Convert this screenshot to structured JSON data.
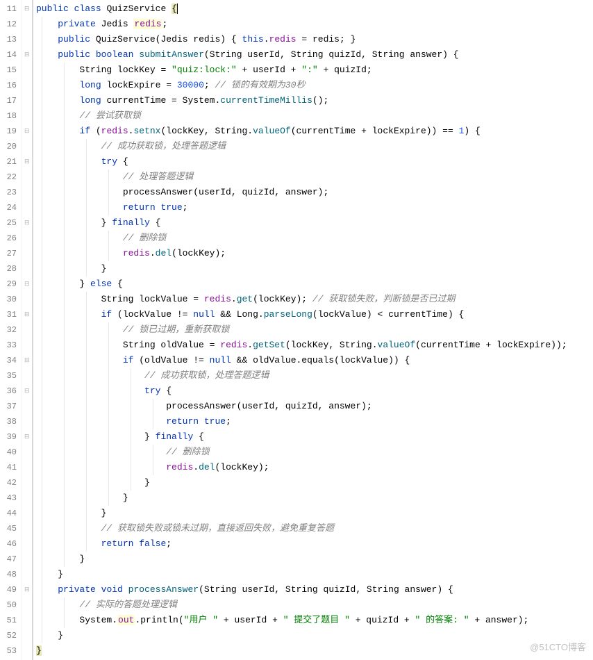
{
  "lines": [
    {
      "num": "11",
      "indent": 0,
      "tokens": [
        {
          "t": "public",
          "c": "kw"
        },
        {
          "t": " ",
          "c": ""
        },
        {
          "t": "class",
          "c": "kw"
        },
        {
          "t": " ",
          "c": ""
        },
        {
          "t": "QuizService",
          "c": "cls"
        },
        {
          "t": " ",
          "c": ""
        },
        {
          "t": "{",
          "c": "hl cursor"
        }
      ]
    },
    {
      "num": "12",
      "indent": 1,
      "tokens": [
        {
          "t": "private",
          "c": "kw"
        },
        {
          "t": " ",
          "c": ""
        },
        {
          "t": "Jedis",
          "c": "cls"
        },
        {
          "t": " ",
          "c": ""
        },
        {
          "t": "redis",
          "c": "fld hl2"
        },
        {
          "t": ";",
          "c": "txt"
        }
      ]
    },
    {
      "num": "13",
      "indent": 1,
      "tokens": [
        {
          "t": "public",
          "c": "kw"
        },
        {
          "t": " ",
          "c": ""
        },
        {
          "t": "QuizService",
          "c": "cls"
        },
        {
          "t": "(",
          "c": "txt"
        },
        {
          "t": "Jedis",
          "c": "cls"
        },
        {
          "t": " redis) { ",
          "c": "txt"
        },
        {
          "t": "this",
          "c": "kw"
        },
        {
          "t": ".",
          "c": "txt"
        },
        {
          "t": "redis",
          "c": "fld"
        },
        {
          "t": " = redis; }",
          "c": "txt"
        }
      ]
    },
    {
      "num": "14",
      "indent": 1,
      "tokens": [
        {
          "t": "public",
          "c": "kw"
        },
        {
          "t": " ",
          "c": ""
        },
        {
          "t": "boolean",
          "c": "kw"
        },
        {
          "t": " ",
          "c": ""
        },
        {
          "t": "submitAnswer",
          "c": "mth"
        },
        {
          "t": "(String userId, String quizId, String answer) {",
          "c": "txt"
        }
      ]
    },
    {
      "num": "15",
      "indent": 2,
      "tokens": [
        {
          "t": "String lockKey = ",
          "c": "txt"
        },
        {
          "t": "\"quiz:lock:\"",
          "c": "str"
        },
        {
          "t": " + userId + ",
          "c": "txt"
        },
        {
          "t": "\":\"",
          "c": "str"
        },
        {
          "t": " + quizId;",
          "c": "txt"
        }
      ]
    },
    {
      "num": "16",
      "indent": 2,
      "tokens": [
        {
          "t": "long",
          "c": "kw"
        },
        {
          "t": " lockExpire = ",
          "c": "txt"
        },
        {
          "t": "30000",
          "c": "num"
        },
        {
          "t": "; ",
          "c": "txt"
        },
        {
          "t": "// 锁的有效期为30秒",
          "c": "cmt"
        }
      ]
    },
    {
      "num": "17",
      "indent": 2,
      "tokens": [
        {
          "t": "long",
          "c": "kw"
        },
        {
          "t": " currentTime = System.",
          "c": "txt"
        },
        {
          "t": "currentTimeMillis",
          "c": "mth"
        },
        {
          "t": "();",
          "c": "txt"
        }
      ]
    },
    {
      "num": "18",
      "indent": 2,
      "tokens": [
        {
          "t": "// 尝试获取锁",
          "c": "cmt"
        }
      ]
    },
    {
      "num": "19",
      "indent": 2,
      "tokens": [
        {
          "t": "if",
          "c": "kw"
        },
        {
          "t": " (",
          "c": "txt"
        },
        {
          "t": "redis",
          "c": "fld"
        },
        {
          "t": ".",
          "c": "txt"
        },
        {
          "t": "setnx",
          "c": "mth"
        },
        {
          "t": "(lockKey, String.",
          "c": "txt"
        },
        {
          "t": "valueOf",
          "c": "mth"
        },
        {
          "t": "(currentTime + lockExpire)) == ",
          "c": "txt"
        },
        {
          "t": "1",
          "c": "num"
        },
        {
          "t": ") {",
          "c": "txt"
        }
      ]
    },
    {
      "num": "20",
      "indent": 3,
      "tokens": [
        {
          "t": "// 成功获取锁，处理答题逻辑",
          "c": "cmt"
        }
      ]
    },
    {
      "num": "21",
      "indent": 3,
      "tokens": [
        {
          "t": "try",
          "c": "kw"
        },
        {
          "t": " {",
          "c": "txt"
        }
      ]
    },
    {
      "num": "22",
      "indent": 4,
      "tokens": [
        {
          "t": "// 处理答题逻辑",
          "c": "cmt"
        }
      ]
    },
    {
      "num": "23",
      "indent": 4,
      "tokens": [
        {
          "t": "processAnswer(userId, quizId, answer);",
          "c": "txt"
        }
      ]
    },
    {
      "num": "24",
      "indent": 4,
      "tokens": [
        {
          "t": "return",
          "c": "kw"
        },
        {
          "t": " ",
          "c": ""
        },
        {
          "t": "true",
          "c": "kw"
        },
        {
          "t": ";",
          "c": "txt"
        }
      ]
    },
    {
      "num": "25",
      "indent": 3,
      "tokens": [
        {
          "t": "} ",
          "c": "txt"
        },
        {
          "t": "finally",
          "c": "kw"
        },
        {
          "t": " {",
          "c": "txt"
        }
      ]
    },
    {
      "num": "26",
      "indent": 4,
      "tokens": [
        {
          "t": "// 删除锁",
          "c": "cmt"
        }
      ]
    },
    {
      "num": "27",
      "indent": 4,
      "tokens": [
        {
          "t": "redis",
          "c": "fld"
        },
        {
          "t": ".",
          "c": "txt"
        },
        {
          "t": "del",
          "c": "mth"
        },
        {
          "t": "(lockKey);",
          "c": "txt"
        }
      ]
    },
    {
      "num": "28",
      "indent": 3,
      "tokens": [
        {
          "t": "}",
          "c": "txt"
        }
      ]
    },
    {
      "num": "29",
      "indent": 2,
      "tokens": [
        {
          "t": "} ",
          "c": "txt"
        },
        {
          "t": "else",
          "c": "kw"
        },
        {
          "t": " {",
          "c": "txt"
        }
      ]
    },
    {
      "num": "30",
      "indent": 3,
      "tokens": [
        {
          "t": "String lockValue = ",
          "c": "txt"
        },
        {
          "t": "redis",
          "c": "fld"
        },
        {
          "t": ".",
          "c": "txt"
        },
        {
          "t": "get",
          "c": "mth"
        },
        {
          "t": "(lockKey); ",
          "c": "txt"
        },
        {
          "t": "// 获取锁失败，判断锁是否已过期",
          "c": "cmt"
        }
      ]
    },
    {
      "num": "31",
      "indent": 3,
      "tokens": [
        {
          "t": "if",
          "c": "kw"
        },
        {
          "t": " (lockValue != ",
          "c": "txt"
        },
        {
          "t": "null",
          "c": "kw"
        },
        {
          "t": " && Long.",
          "c": "txt"
        },
        {
          "t": "parseLong",
          "c": "mth"
        },
        {
          "t": "(lockValue) < currentTime) {",
          "c": "txt"
        }
      ]
    },
    {
      "num": "32",
      "indent": 4,
      "tokens": [
        {
          "t": "// 锁已过期，重新获取锁",
          "c": "cmt"
        }
      ]
    },
    {
      "num": "33",
      "indent": 4,
      "tokens": [
        {
          "t": "String oldValue = ",
          "c": "txt"
        },
        {
          "t": "redis",
          "c": "fld"
        },
        {
          "t": ".",
          "c": "txt"
        },
        {
          "t": "getSet",
          "c": "mth"
        },
        {
          "t": "(lockKey, String.",
          "c": "txt"
        },
        {
          "t": "valueOf",
          "c": "mth"
        },
        {
          "t": "(currentTime + lockExpire));",
          "c": "txt"
        }
      ]
    },
    {
      "num": "34",
      "indent": 4,
      "tokens": [
        {
          "t": "if",
          "c": "kw"
        },
        {
          "t": " (oldValue != ",
          "c": "txt"
        },
        {
          "t": "null",
          "c": "kw"
        },
        {
          "t": " && oldValue.equals(lockValue)) {",
          "c": "txt"
        }
      ]
    },
    {
      "num": "35",
      "indent": 5,
      "tokens": [
        {
          "t": "// 成功获取锁，处理答题逻辑",
          "c": "cmt"
        }
      ]
    },
    {
      "num": "36",
      "indent": 5,
      "tokens": [
        {
          "t": "try",
          "c": "kw"
        },
        {
          "t": " {",
          "c": "txt"
        }
      ]
    },
    {
      "num": "37",
      "indent": 6,
      "tokens": [
        {
          "t": "processAnswer(userId, quizId, answer);",
          "c": "txt"
        }
      ]
    },
    {
      "num": "38",
      "indent": 6,
      "tokens": [
        {
          "t": "return",
          "c": "kw"
        },
        {
          "t": " ",
          "c": ""
        },
        {
          "t": "true",
          "c": "kw"
        },
        {
          "t": ";",
          "c": "txt"
        }
      ]
    },
    {
      "num": "39",
      "indent": 5,
      "tokens": [
        {
          "t": "} ",
          "c": "txt"
        },
        {
          "t": "finally",
          "c": "kw"
        },
        {
          "t": " {",
          "c": "txt"
        }
      ]
    },
    {
      "num": "40",
      "indent": 6,
      "tokens": [
        {
          "t": "// 删除锁",
          "c": "cmt"
        }
      ]
    },
    {
      "num": "41",
      "indent": 6,
      "tokens": [
        {
          "t": "redis",
          "c": "fld"
        },
        {
          "t": ".",
          "c": "txt"
        },
        {
          "t": "del",
          "c": "mth"
        },
        {
          "t": "(lockKey);",
          "c": "txt"
        }
      ]
    },
    {
      "num": "42",
      "indent": 5,
      "tokens": [
        {
          "t": "}",
          "c": "txt"
        }
      ]
    },
    {
      "num": "43",
      "indent": 4,
      "tokens": [
        {
          "t": "}",
          "c": "txt"
        }
      ]
    },
    {
      "num": "44",
      "indent": 3,
      "tokens": [
        {
          "t": "}",
          "c": "txt"
        }
      ]
    },
    {
      "num": "45",
      "indent": 3,
      "tokens": [
        {
          "t": "// 获取锁失败或锁未过期，直接返回失败，避免重复答题",
          "c": "cmt"
        }
      ]
    },
    {
      "num": "46",
      "indent": 3,
      "tokens": [
        {
          "t": "return",
          "c": "kw"
        },
        {
          "t": " ",
          "c": ""
        },
        {
          "t": "false",
          "c": "kw"
        },
        {
          "t": ";",
          "c": "txt"
        }
      ]
    },
    {
      "num": "47",
      "indent": 2,
      "tokens": [
        {
          "t": "}",
          "c": "txt"
        }
      ]
    },
    {
      "num": "48",
      "indent": 1,
      "tokens": [
        {
          "t": "}",
          "c": "txt"
        }
      ]
    },
    {
      "num": "49",
      "indent": 1,
      "tokens": [
        {
          "t": "private",
          "c": "kw"
        },
        {
          "t": " ",
          "c": ""
        },
        {
          "t": "void",
          "c": "kw"
        },
        {
          "t": " ",
          "c": ""
        },
        {
          "t": "processAnswer",
          "c": "mth"
        },
        {
          "t": "(String userId, String quizId, String answer) {",
          "c": "txt"
        }
      ]
    },
    {
      "num": "50",
      "indent": 2,
      "tokens": [
        {
          "t": "// 实际的答题处理逻辑",
          "c": "cmt"
        }
      ]
    },
    {
      "num": "51",
      "indent": 2,
      "tokens": [
        {
          "t": "System.",
          "c": "txt"
        },
        {
          "t": "out",
          "c": "fld hl2"
        },
        {
          "t": ".println(",
          "c": "txt"
        },
        {
          "t": "\"用户 \"",
          "c": "str"
        },
        {
          "t": " + userId + ",
          "c": "txt"
        },
        {
          "t": "\" 提交了题目 \"",
          "c": "str"
        },
        {
          "t": " + quizId + ",
          "c": "txt"
        },
        {
          "t": "\" 的答案: \"",
          "c": "str"
        },
        {
          "t": " + answer);",
          "c": "txt"
        }
      ]
    },
    {
      "num": "52",
      "indent": 1,
      "tokens": [
        {
          "t": "}",
          "c": "txt"
        }
      ]
    },
    {
      "num": "53",
      "indent": 0,
      "tokens": [
        {
          "t": "}",
          "c": "hl"
        }
      ]
    }
  ],
  "watermark": "@51CTO博客",
  "foldMarkers": [
    "11",
    "14",
    "19",
    "21",
    "25",
    "29",
    "31",
    "34",
    "36",
    "39",
    "49"
  ]
}
